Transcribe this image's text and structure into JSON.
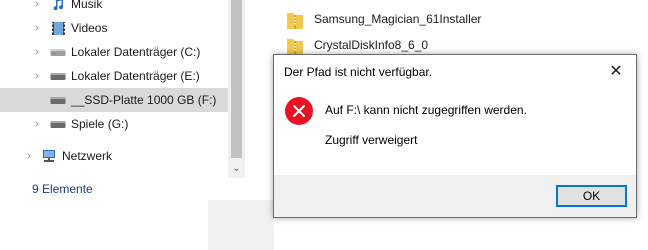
{
  "nav": {
    "items": [
      {
        "label": "Musik",
        "icon": "music-icon"
      },
      {
        "label": "Videos",
        "icon": "videos-icon"
      },
      {
        "label": "Lokaler Datenträger (C:)",
        "icon": "drive-icon"
      },
      {
        "label": "Lokaler Datenträger (E:)",
        "icon": "drive-icon"
      },
      {
        "label": "__SSD-Platte 1000 GB (F:)",
        "icon": "drive-icon",
        "selected": true
      },
      {
        "label": "Spiele (G:)",
        "icon": "drive-icon"
      },
      {
        "label": "Netzwerk",
        "icon": "network-icon"
      }
    ]
  },
  "status": {
    "item_count": "9 Elemente"
  },
  "files": [
    {
      "name": "Samsung_Magician_61Installer"
    },
    {
      "name": "CrystalDiskInfo8_6_0"
    }
  ],
  "dialog": {
    "title": "Der Pfad ist nicht verfügbar.",
    "message": "Auf F:\\ kann nicht zugegriffen werden.",
    "detail": "Zugriff verweigert",
    "ok_label": "OK",
    "close_glyph": "✕"
  },
  "colors": {
    "error": "#e81123",
    "accent": "#0078d7",
    "selection": "#d9d9d9"
  }
}
